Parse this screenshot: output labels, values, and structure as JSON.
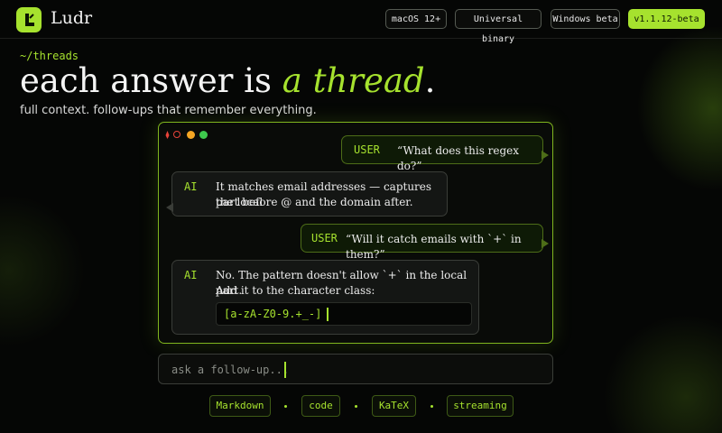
{
  "app": {
    "name": "Ludr"
  },
  "header": {
    "platforms": [
      "macOS 12+",
      "Universal binary",
      "Windows beta"
    ],
    "version": "v1.1.12-beta"
  },
  "hero": {
    "eyebrow": "~/threads",
    "headline_lead": "each answer is ",
    "headline_emphasis": "a thread",
    "headline_end": ".",
    "subline": "full context. follow-ups that remember everything."
  },
  "chat": {
    "window_dots": [
      "#e8443a",
      "#f5a623",
      "#3ec94d"
    ],
    "messages": [
      {
        "role": "USER",
        "text": "“What does this regex do?”"
      },
      {
        "role": "AI",
        "text_lines": [
          "It matches email addresses — captures the local",
          "part before @ and the domain after."
        ]
      },
      {
        "role": "USER",
        "text": "“Will it catch emails with `+` in them?”"
      },
      {
        "role": "AI",
        "text_lines": [
          "No. The pattern doesn't allow `+` in the local part.",
          "Add it to the character class:"
        ],
        "code": "[a-zA-Z0-9.+_-]"
      }
    ]
  },
  "followup": {
    "placeholder": "ask a follow-up..."
  },
  "features": [
    "Markdown",
    "code",
    "KaTeX",
    "streaming"
  ],
  "colors": {
    "accent": "#a6e22e",
    "background": "#050605"
  }
}
